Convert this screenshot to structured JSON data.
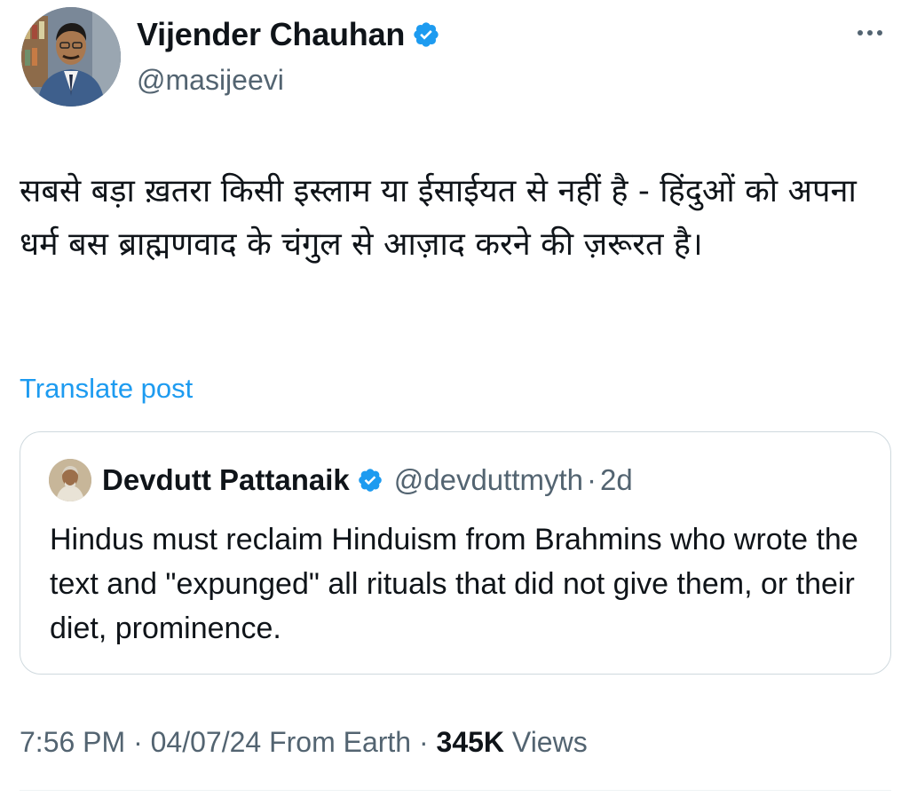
{
  "author": {
    "display_name": "Vijender Chauhan",
    "handle": "@masijeevi",
    "verified": true,
    "avatar_icon": "profile-photo"
  },
  "post": {
    "text": "सबसे बड़ा ख़तरा किसी इस्लाम या ईसाईयत से नहीं है - हिंदुओं को अपना धर्म बस ब्राह्मणवाद के चंगुल से आज़ाद करने की ज़रूरत है।",
    "translate_label": "Translate post"
  },
  "quoted_post": {
    "display_name": "Devdutt Pattanaik",
    "handle": "@devduttmyth",
    "separator": "·",
    "time": "2d",
    "verified": true,
    "text": "Hindus must reclaim Hinduism from Brahmins who wrote the text and \"expunged\" all rituals that did not give them, or their diet, prominence."
  },
  "meta": {
    "time": "7:56 PM",
    "date": "04/07/24",
    "source": "From Earth",
    "separator": "·",
    "views_count": "345K",
    "views_label": "Views"
  },
  "colors": {
    "link": "#1d9bf0",
    "verified": "#1d9bf0",
    "secondary_text": "#536471",
    "border": "#cfd9de"
  }
}
